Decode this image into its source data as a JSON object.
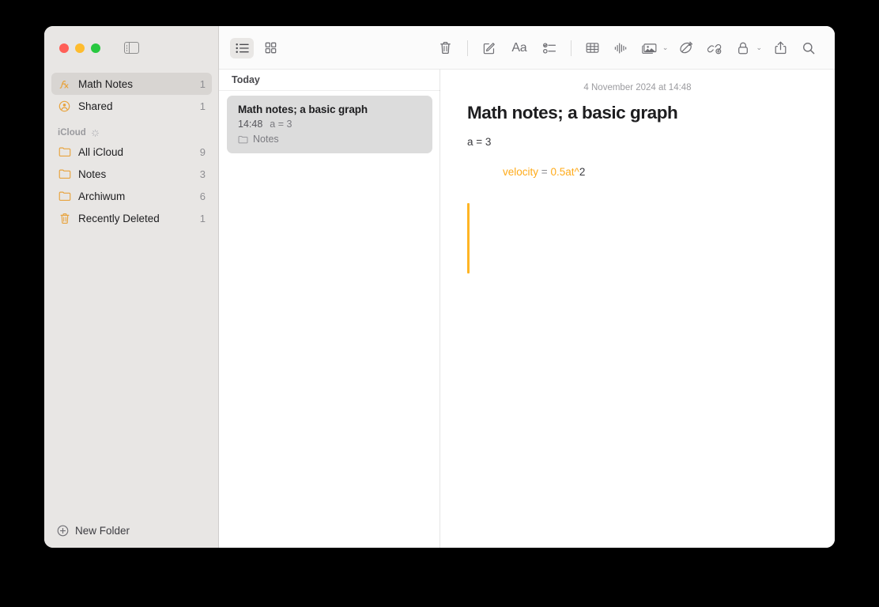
{
  "window": {
    "traffic_lights": [
      "close",
      "minimize",
      "zoom"
    ],
    "colors": {
      "red": "#ff5f57",
      "yellow": "#febc2e",
      "green": "#28c840",
      "accent_orange": "#ffab1a",
      "sidebar_bg": "#e8e6e4",
      "selected_row": "#d8d5d2",
      "note_item_bg": "#dcdcdc"
    }
  },
  "sidebar": {
    "toggle_icon": "sidebar-toggle-icon",
    "top_items": [
      {
        "label": "Math Notes",
        "count": "1",
        "icon": "function-graph-icon",
        "selected": true
      },
      {
        "label": "Shared",
        "count": "1",
        "icon": "person-circle-icon",
        "selected": false
      }
    ],
    "section": {
      "title": "iCloud",
      "icon": "sync-icon"
    },
    "folders": [
      {
        "label": "All iCloud",
        "count": "9",
        "icon": "folder-icon"
      },
      {
        "label": "Notes",
        "count": "3",
        "icon": "folder-icon"
      },
      {
        "label": "Archiwum",
        "count": "6",
        "icon": "folder-icon"
      },
      {
        "label": "Recently Deleted",
        "count": "1",
        "icon": "trash-icon"
      }
    ],
    "footer": {
      "label": "New Folder",
      "icon": "plus-circle-icon"
    }
  },
  "toolbar": {
    "view_list": {
      "name": "list-view-icon",
      "active": true
    },
    "view_grid": {
      "name": "grid-view-icon",
      "active": false
    },
    "delete": {
      "name": "trash-icon"
    },
    "compose": {
      "name": "compose-icon"
    },
    "format": {
      "name": "format-aa-icon",
      "glyph": "Aa"
    },
    "checklist": {
      "name": "checklist-icon"
    },
    "table": {
      "name": "table-icon"
    },
    "audio": {
      "name": "audio-waveform-icon"
    },
    "media": {
      "name": "media-icon",
      "chevron": "⌄"
    },
    "markup": {
      "name": "markup-icon"
    },
    "link": {
      "name": "link-icon"
    },
    "lock": {
      "name": "lock-icon",
      "chevron": "⌄"
    },
    "share": {
      "name": "share-icon"
    },
    "search": {
      "name": "search-icon"
    }
  },
  "note_list": {
    "section_header": "Today",
    "items": [
      {
        "title": "Math notes; a basic graph",
        "time": "14:48",
        "preview": "a = 3",
        "folder": "Notes",
        "selected": true
      }
    ]
  },
  "detail": {
    "date": "4 November 2024 at 14:48",
    "title": "Math notes; a basic graph",
    "lines": [
      {
        "text": "a = 3"
      }
    ],
    "equation": {
      "lhs": "velocity",
      "operator": "=",
      "rhs_accent": "0.5at^",
      "rhs_plain": "2"
    }
  }
}
